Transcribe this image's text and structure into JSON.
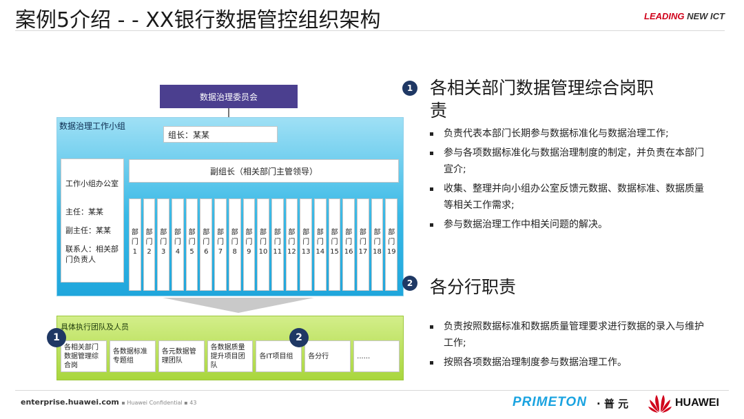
{
  "header": {
    "title": "案例5介绍 - - XX银行数据管控组织架构",
    "brand_leading": "LEADING",
    "brand_new_ict": " NEW ICT"
  },
  "diagram": {
    "committee": "数据治理委员会",
    "working_group": "数据治理工作小组",
    "leader": "组长：某某",
    "office": {
      "title": "工作小组办公室",
      "director": "主任：某某",
      "deputy_director": "副主任：某某",
      "contact": "联系人：相关部门负责人"
    },
    "deputy_leader": "副组长（相关部门主管领导）",
    "dept_prefix": "部门",
    "dept_numbers": [
      "1",
      "2",
      "3",
      "4",
      "5",
      "6",
      "7",
      "8",
      "9",
      "10",
      "11",
      "12",
      "13",
      "14",
      "15",
      "16",
      "17",
      "18",
      "19"
    ],
    "execution_team": "具体执行团队及人员",
    "teams": [
      "各相关部门数据管理综合岗",
      "各数据标准专题组",
      "各元数据管理团队",
      "各数据质量提升项目团队",
      "各IT项目组",
      "各分行",
      "......"
    ],
    "badge1": "1",
    "badge2": "2"
  },
  "right": {
    "s1_num": "1",
    "s1_title": "各相关部门数据管理综合岗职责",
    "s1_bullets": [
      "负责代表本部门长期参与数据标准化与数据治理工作;",
      "参与各项数据标准化与数据治理制度的制定，并负责在本部门宣介;",
      "收集、整理并向小组办公室反馈元数据、数据标准、数据质量等相关工作需求;",
      "参与数据治理工作中相关问题的解决。"
    ],
    "s2_num": "2",
    "s2_title": "各分行职责",
    "s2_bullets": [
      "负责按照数据标准和数据质量管理要求进行数据的录入与维护工作;",
      "按照各项数据治理制度参与数据治理工作。"
    ]
  },
  "footer": {
    "site": "enterprise.huawei.com",
    "confidential": "▪ Huawei Confidential ▪ 43",
    "primeton": "PRIMETON",
    "puyuan": "· 普 元",
    "huawei": "HUAWEI"
  },
  "colors": {
    "committee": "#4b3f8f",
    "cyan_panel": "#39b9e6",
    "green_panel": "#a9d63d",
    "badge": "#1f3864",
    "huawei_red": "#d0021b",
    "primeton_blue": "#1aa3e0"
  }
}
